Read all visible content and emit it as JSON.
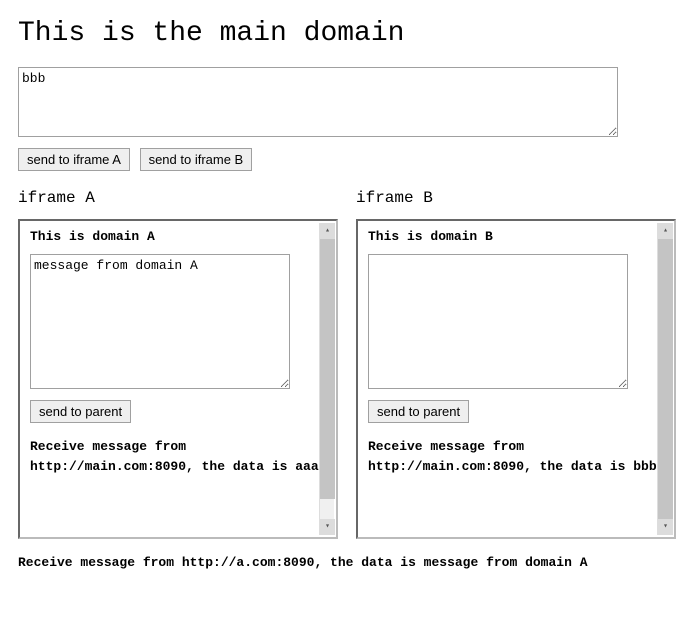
{
  "main": {
    "title": "This is the main domain",
    "textarea_value": "bbb",
    "buttons": {
      "send_a": "send to iframe A",
      "send_b": "send to iframe B"
    },
    "receive_message": "Receive message from http://a.com:8090, the data is message from domain A"
  },
  "iframes": {
    "a": {
      "label": "iframe A",
      "heading": "This is domain A",
      "textarea_value": "message from domain A",
      "send_button": "send to parent",
      "receive_message": "Receive message from http://main.com:8090, the data is aaa"
    },
    "b": {
      "label": "iframe B",
      "heading": "This is domain B",
      "textarea_value": "",
      "send_button": "send to parent",
      "receive_message": "Receive message from http://main.com:8090, the data is bbb"
    }
  }
}
